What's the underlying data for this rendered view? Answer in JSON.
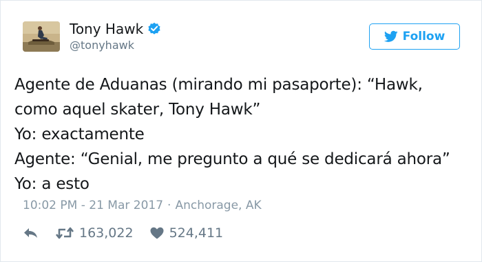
{
  "author": {
    "display_name": "Tony Hawk",
    "handle": "@tonyhawk",
    "verified": true
  },
  "follow_button": {
    "label": "Follow"
  },
  "tweet": {
    "lines": [
      "Agente de Aduanas (mirando mi pasaporte): “Hawk,",
      "como aquel skater, Tony Hawk”",
      "Yo: exactamente",
      "Agente: “Genial, me pregunto a qué se dedicará ahora”",
      "Yo: a esto"
    ],
    "time": "10:02 PM - 21 Mar 2017",
    "separator": "·",
    "location": "Anchorage, AK"
  },
  "stats": {
    "retweets": "163,022",
    "likes": "524,411"
  },
  "icons": {
    "avatar": "avatar-photo",
    "verified": "verified-badge-icon",
    "follow": "twitter-bird-icon",
    "reply": "reply-icon",
    "retweet": "retweet-icon",
    "like": "heart-icon"
  },
  "colors": {
    "brand_blue": "#1da1f2",
    "text": "#14171a",
    "muted": "#657786",
    "light_muted": "#8899a6",
    "border": "#e1e8ed"
  }
}
